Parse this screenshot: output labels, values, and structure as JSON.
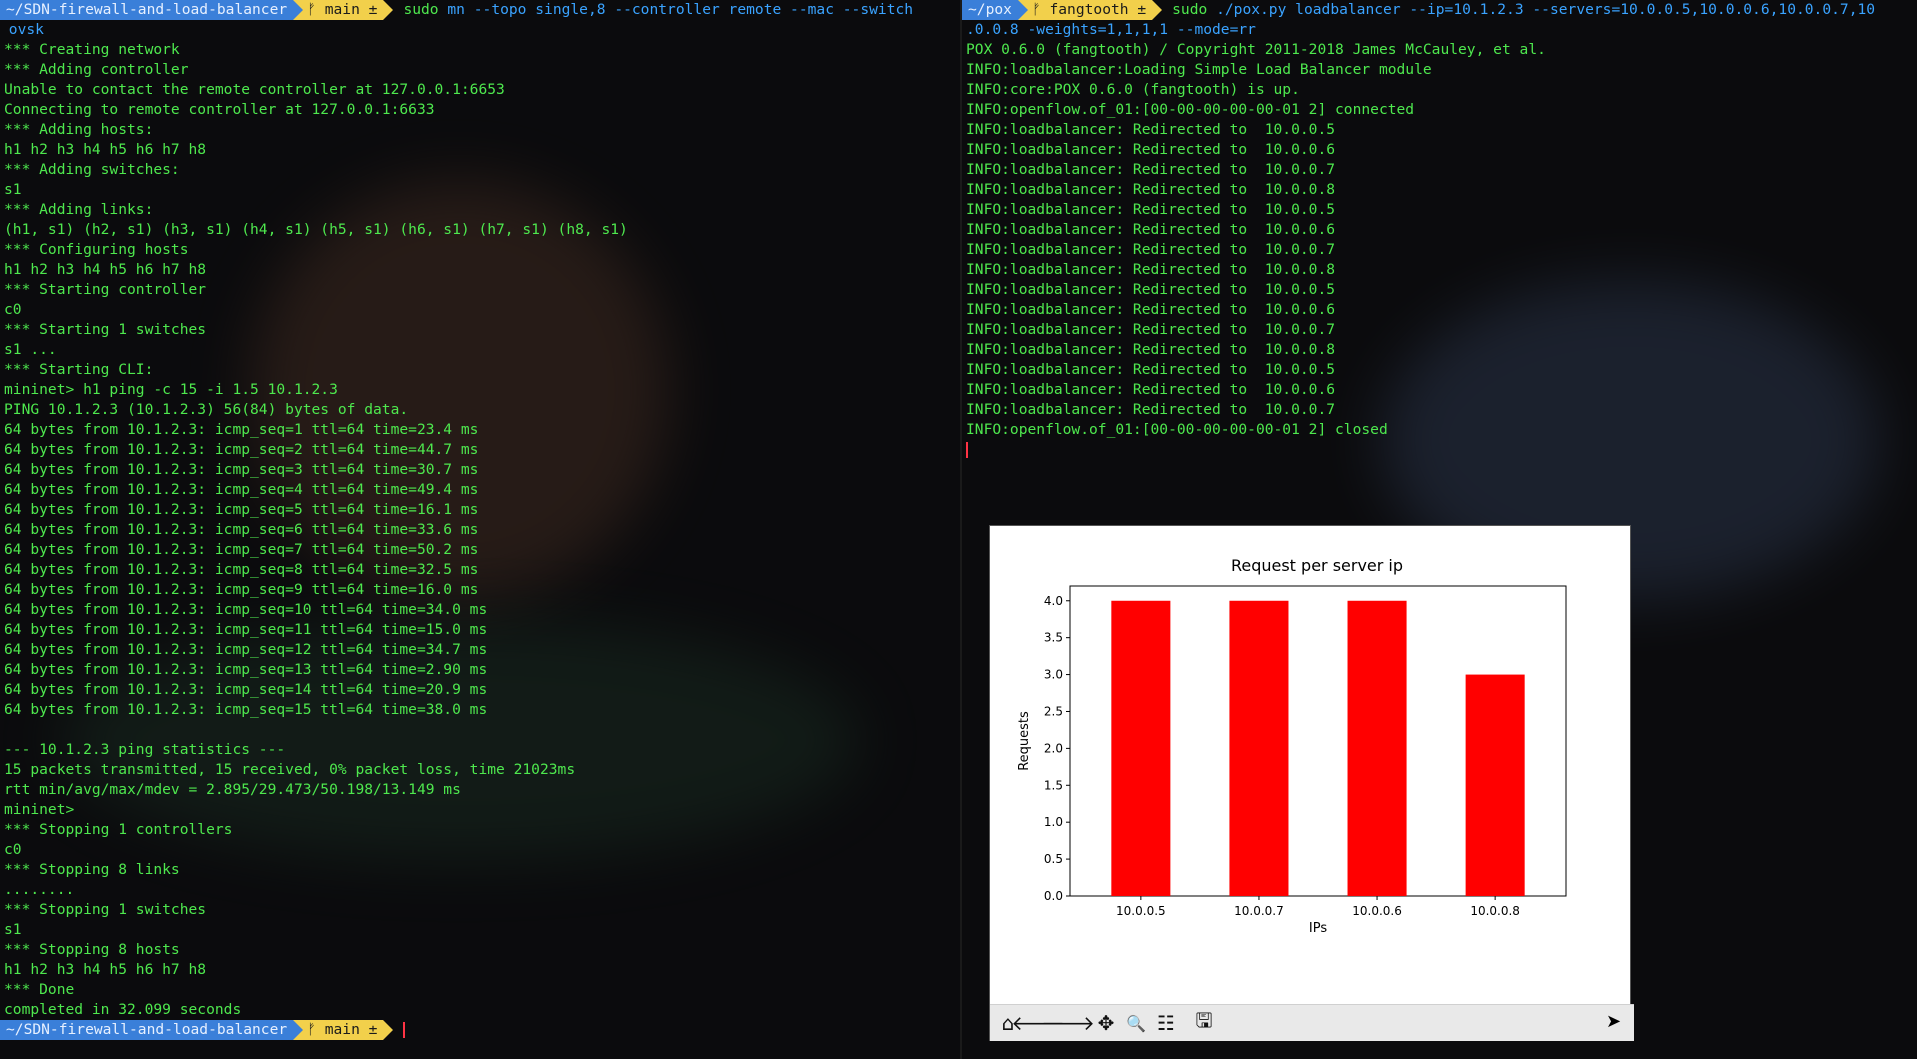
{
  "left_terminal": {
    "prompt_path": "~/SDN-firewall-and-load-balancer",
    "prompt_branch": "ᚠ main ±",
    "command_sudo": "sudo",
    "command": "mn --topo single,8 --controller remote --mac --switch",
    "command_cont": " ovsk",
    "lines": [
      "*** Creating network",
      "*** Adding controller",
      "Unable to contact the remote controller at 127.0.0.1:6653",
      "Connecting to remote controller at 127.0.0.1:6633",
      "*** Adding hosts:",
      "h1 h2 h3 h4 h5 h6 h7 h8",
      "*** Adding switches:",
      "s1",
      "*** Adding links:",
      "(h1, s1) (h2, s1) (h3, s1) (h4, s1) (h5, s1) (h6, s1) (h7, s1) (h8, s1)",
      "*** Configuring hosts",
      "h1 h2 h3 h4 h5 h6 h7 h8",
      "*** Starting controller",
      "c0",
      "*** Starting 1 switches",
      "s1 ...",
      "*** Starting CLI:",
      "mininet> h1 ping -c 15 -i 1.5 10.1.2.3",
      "PING 10.1.2.3 (10.1.2.3) 56(84) bytes of data.",
      "64 bytes from 10.1.2.3: icmp_seq=1 ttl=64 time=23.4 ms",
      "64 bytes from 10.1.2.3: icmp_seq=2 ttl=64 time=44.7 ms",
      "64 bytes from 10.1.2.3: icmp_seq=3 ttl=64 time=30.7 ms",
      "64 bytes from 10.1.2.3: icmp_seq=4 ttl=64 time=49.4 ms",
      "64 bytes from 10.1.2.3: icmp_seq=5 ttl=64 time=16.1 ms",
      "64 bytes from 10.1.2.3: icmp_seq=6 ttl=64 time=33.6 ms",
      "64 bytes from 10.1.2.3: icmp_seq=7 ttl=64 time=50.2 ms",
      "64 bytes from 10.1.2.3: icmp_seq=8 ttl=64 time=32.5 ms",
      "64 bytes from 10.1.2.3: icmp_seq=9 ttl=64 time=16.0 ms",
      "64 bytes from 10.1.2.3: icmp_seq=10 ttl=64 time=34.0 ms",
      "64 bytes from 10.1.2.3: icmp_seq=11 ttl=64 time=15.0 ms",
      "64 bytes from 10.1.2.3: icmp_seq=12 ttl=64 time=34.7 ms",
      "64 bytes from 10.1.2.3: icmp_seq=13 ttl=64 time=2.90 ms",
      "64 bytes from 10.1.2.3: icmp_seq=14 ttl=64 time=20.9 ms",
      "64 bytes from 10.1.2.3: icmp_seq=15 ttl=64 time=38.0 ms",
      "",
      "--- 10.1.2.3 ping statistics ---",
      "15 packets transmitted, 15 received, 0% packet loss, time 21023ms",
      "rtt min/avg/max/mdev = 2.895/29.473/50.198/13.149 ms",
      "mininet>",
      "*** Stopping 1 controllers",
      "c0",
      "*** Stopping 8 links",
      "........",
      "*** Stopping 1 switches",
      "s1",
      "*** Stopping 8 hosts",
      "h1 h2 h3 h4 h5 h6 h7 h8",
      "*** Done",
      "completed in 32.099 seconds"
    ]
  },
  "right_terminal": {
    "prompt_path": "~/pox",
    "prompt_branch": "ᚠ fangtooth ±",
    "command_sudo": "sudo",
    "command": "./pox.py loadbalancer --ip=10.1.2.3 --servers=10.0.0.5,10.0.0.6,10.0.0.7,10",
    "command_cont": ".0.0.8 -weights=1,1,1,1 --mode=rr",
    "lines": [
      "POX 0.6.0 (fangtooth) / Copyright 2011-2018 James McCauley, et al.",
      "INFO:loadbalancer:Loading Simple Load Balancer module",
      "INFO:core:POX 0.6.0 (fangtooth) is up.",
      "INFO:openflow.of_01:[00-00-00-00-00-01 2] connected",
      "INFO:loadbalancer: Redirected to  10.0.0.5",
      "INFO:loadbalancer: Redirected to  10.0.0.6",
      "INFO:loadbalancer: Redirected to  10.0.0.7",
      "INFO:loadbalancer: Redirected to  10.0.0.8",
      "INFO:loadbalancer: Redirected to  10.0.0.5",
      "INFO:loadbalancer: Redirected to  10.0.0.6",
      "INFO:loadbalancer: Redirected to  10.0.0.7",
      "INFO:loadbalancer: Redirected to  10.0.0.8",
      "INFO:loadbalancer: Redirected to  10.0.0.5",
      "INFO:loadbalancer: Redirected to  10.0.0.6",
      "INFO:loadbalancer: Redirected to  10.0.0.7",
      "INFO:loadbalancer: Redirected to  10.0.0.8",
      "INFO:loadbalancer: Redirected to  10.0.0.5",
      "INFO:loadbalancer: Redirected to  10.0.0.6",
      "INFO:loadbalancer: Redirected to  10.0.0.7",
      "INFO:openflow.of_01:[00-00-00-00-00-01 2] closed"
    ]
  },
  "figure": {
    "toolbar": {
      "home_icon": "⌂",
      "back_icon": "🡐",
      "forward_icon": "🡒",
      "pan_icon": "✥",
      "zoom_icon": "🔍",
      "configure_icon": "☷",
      "save_icon": "🖫"
    }
  },
  "chart_data": {
    "type": "bar",
    "title": "Request per server ip",
    "xlabel": "IPs",
    "ylabel": "Requests",
    "categories": [
      "10.0.0.5",
      "10.0.0.7",
      "10.0.0.6",
      "10.0.0.8"
    ],
    "values": [
      4,
      4,
      4,
      3
    ],
    "ylim": [
      0,
      4.2
    ],
    "yticks": [
      "0.0",
      "0.5",
      "1.0",
      "1.5",
      "2.0",
      "2.5",
      "3.0",
      "3.5",
      "4.0"
    ],
    "bar_color": "#ff0000",
    "grid": false
  },
  "colors": {
    "terminal_green": "#4ee84e",
    "command_blue": "#3aa3ff",
    "prompt_blue": "#3a7fd9",
    "prompt_yellow": "#f2d04b"
  }
}
